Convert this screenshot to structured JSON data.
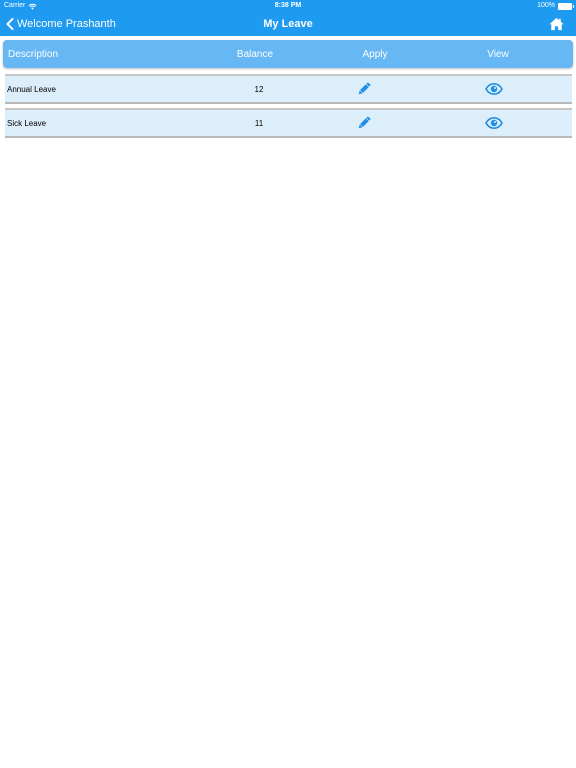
{
  "status_bar": {
    "carrier": "Carrier",
    "time": "8:38 PM",
    "battery": "100%"
  },
  "nav": {
    "back_label": "Welcome Prashanth",
    "title": "My Leave",
    "home_icon": "home-icon"
  },
  "table": {
    "headers": {
      "description": "Description",
      "balance": "Balance",
      "apply": "Apply",
      "view": "View"
    },
    "rows": [
      {
        "description": "Annual Leave",
        "balance": "12",
        "apply_icon": "pencil-icon",
        "view_icon": "eye-icon"
      },
      {
        "description": "Sick Leave",
        "balance": "11",
        "apply_icon": "pencil-icon",
        "view_icon": "eye-icon"
      }
    ]
  },
  "colors": {
    "nav_bg": "#1e9af0",
    "header_bg": "#67b7f4",
    "row_bg": "#ddeefb",
    "icon": "#1e8fe6"
  }
}
